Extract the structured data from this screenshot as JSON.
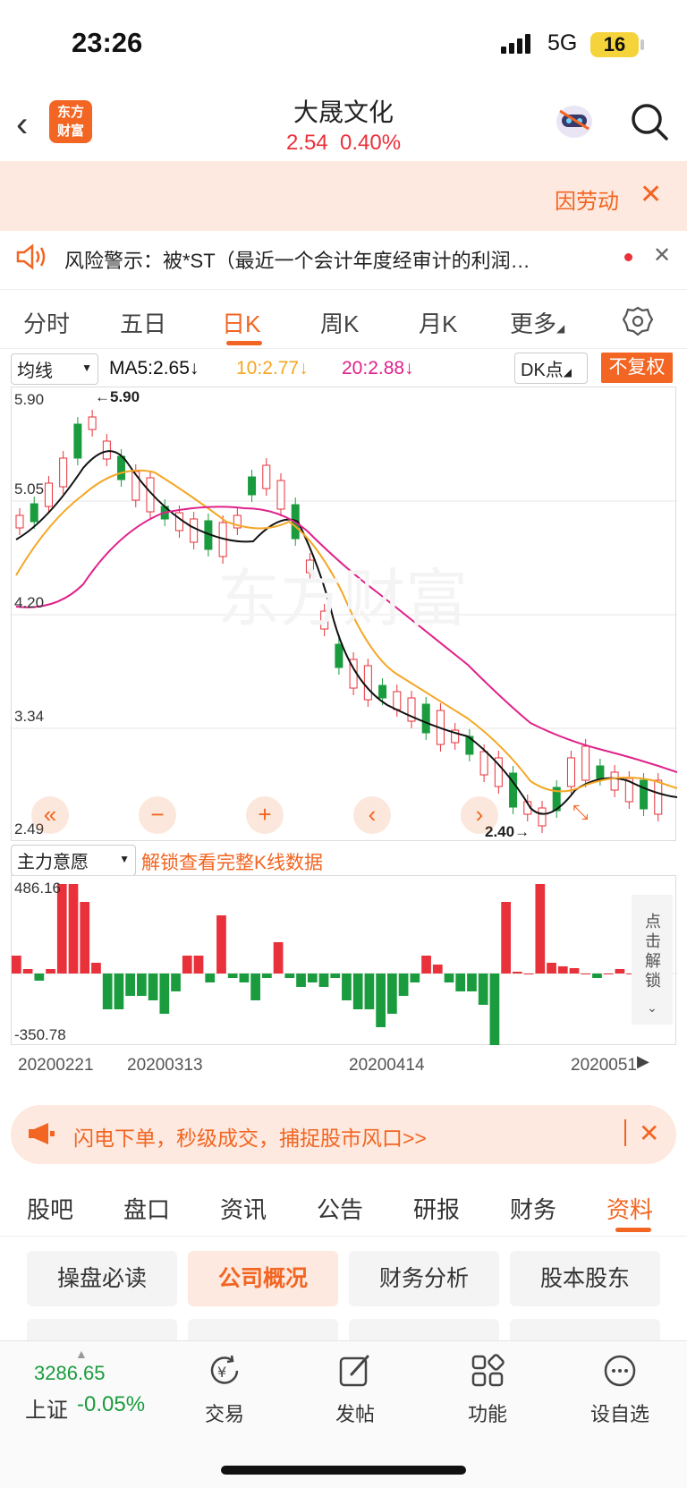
{
  "status": {
    "time": "23:26",
    "network": "5G",
    "battery": "16"
  },
  "header": {
    "logo_line1": "东方",
    "logo_line2": "财富",
    "stock_name": "大晟文化",
    "price": "2.54",
    "change_pct": "0.40%"
  },
  "ad_banner": {
    "text": "因劳动"
  },
  "risk_warning": {
    "text": "风险警示：被*ST（最近一个会计年度经审计的利润…"
  },
  "kline_tabs": [
    {
      "label": "分时"
    },
    {
      "label": "五日"
    },
    {
      "label": "日K"
    },
    {
      "label": "周K"
    },
    {
      "label": "月K"
    },
    {
      "label": "更多"
    }
  ],
  "indicators": {
    "select": "均线",
    "ma5": "MA5:2.65↓",
    "ma10": "10:2.77↓",
    "ma20": "20:2.88↓",
    "dk": "DK点",
    "adjust_button": "不复权"
  },
  "price_axis": {
    "top": "5.90",
    "l1": "5.05",
    "l2": "4.20",
    "l3": "3.34",
    "bottom": "2.49"
  },
  "annotations": {
    "high": "5.90",
    "low": "2.40"
  },
  "subchart": {
    "select": "主力意愿",
    "unlock_text": "解锁查看完整K线数据",
    "max_label": "486.16",
    "min_label": "-350.78",
    "side_unlock": "点击解锁"
  },
  "dates": [
    "20200221",
    "20200313",
    "20200414",
    "2020051"
  ],
  "promo": {
    "text": "闪电下单，秒级成交，捕捉股市风口>>"
  },
  "section_tabs": [
    {
      "label": "股吧"
    },
    {
      "label": "盘口"
    },
    {
      "label": "资讯"
    },
    {
      "label": "公告"
    },
    {
      "label": "研报"
    },
    {
      "label": "财务"
    },
    {
      "label": "资料"
    }
  ],
  "info_chips": [
    {
      "label": "操盘必读"
    },
    {
      "label": "公司概况"
    },
    {
      "label": "财务分析"
    },
    {
      "label": "股本股东"
    }
  ],
  "bottom_nav": {
    "index_value": "3286.65",
    "index_name": "上证",
    "index_change": "-0.05%",
    "items": [
      {
        "label": "交易"
      },
      {
        "label": "发帖"
      },
      {
        "label": "功能"
      },
      {
        "label": "设自选"
      }
    ]
  },
  "colors": {
    "up": "#e8313a",
    "down": "#1a9c3e",
    "accent": "#f26522",
    "ma5": "#111111",
    "ma10": "#f5a623",
    "ma20": "#e0218a"
  }
}
